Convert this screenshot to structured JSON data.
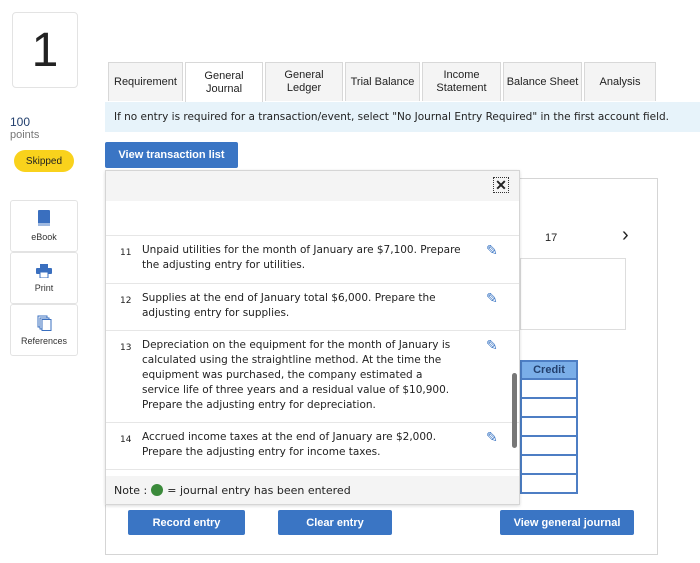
{
  "question": {
    "number": "1",
    "points_value": "100",
    "points_label": "points",
    "status": "Skipped"
  },
  "tools": [
    {
      "label": "eBook",
      "icon": "book-icon"
    },
    {
      "label": "Print",
      "icon": "printer-icon"
    },
    {
      "label": "References",
      "icon": "documents-icon"
    }
  ],
  "tabs": [
    {
      "label": "Requirement"
    },
    {
      "label": "General Journal",
      "active": true
    },
    {
      "label": "General Ledger"
    },
    {
      "label": "Trial Balance"
    },
    {
      "label": "Income Statement"
    },
    {
      "label": "Balance Sheet"
    },
    {
      "label": "Analysis"
    }
  ],
  "info": "If no entry is required for a transaction/event, select \"No Journal Entry Required\" in the first account field.",
  "view_transaction_list": "View transaction list",
  "transactions": [
    {
      "num": "11",
      "text": "Unpaid utilities for the month of January are $7,100. Prepare the adjusting entry for utilities."
    },
    {
      "num": "12",
      "text": "Supplies at the end of January total $6,000. Prepare the adjusting entry for supplies."
    },
    {
      "num": "13",
      "text": "Depreciation on the equipment for the month of January is calculated using the straightline method. At the time the equipment was purchased, the company estimated a service life of three years and a residual value of $10,900. Prepare the adjusting entry for depreciation."
    },
    {
      "num": "14",
      "text": "Accrued income taxes at the end of January are $2,000. Prepare the adjusting entry for income taxes."
    }
  ],
  "note": {
    "prefix": "Note :",
    "suffix": "= journal entry has been entered"
  },
  "journal": {
    "page": "17",
    "next": "›",
    "credit_header": "Credit"
  },
  "buttons": {
    "record": "Record entry",
    "clear": "Clear entry",
    "view_journal": "View general journal"
  },
  "colors": {
    "accent": "#3a75c4",
    "skipped": "#f9d21c",
    "entered": "#3b8a3b",
    "info_bg": "#e7f3fa"
  }
}
